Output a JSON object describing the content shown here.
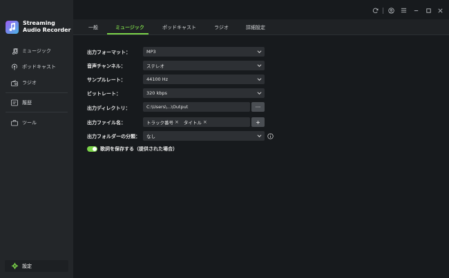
{
  "app": {
    "title_line1": "Streaming",
    "title_line2": "Audio Recorder"
  },
  "sidebar": {
    "items": [
      {
        "label": "ミュージック",
        "icon": "music-note-icon"
      },
      {
        "label": "ポッドキャスト",
        "icon": "podcast-icon"
      },
      {
        "label": "ラジオ",
        "icon": "radio-icon"
      },
      {
        "label": "履歴",
        "icon": "history-icon"
      },
      {
        "label": "ツール",
        "icon": "toolbox-icon"
      }
    ],
    "settings_label": "設定"
  },
  "tabs": [
    {
      "label": "一般"
    },
    {
      "label": "ミュージック",
      "active": true
    },
    {
      "label": "ポッドキャスト"
    },
    {
      "label": "ラジオ"
    },
    {
      "label": "詳細設定"
    }
  ],
  "form": {
    "output_format": {
      "label": "出力フォーマット：",
      "value": "MP3"
    },
    "audio_channel": {
      "label": "音声チャンネル：",
      "value": "ステレオ"
    },
    "sample_rate": {
      "label": "サンプルレート：",
      "value": "44100 Hz"
    },
    "bit_rate": {
      "label": "ビットレート：",
      "value": "320 kbps"
    },
    "output_dir": {
      "label": "出力ディレクトリ：",
      "value": "C:\\Users\\...\\Output",
      "browse": "···"
    },
    "output_filename": {
      "label": "出力ファイル名：",
      "tags": [
        "トラック番号",
        "タイトル"
      ],
      "add": "+"
    },
    "folder_classification": {
      "label": "出力フォルダーの分類：",
      "value": "なし"
    },
    "save_lyrics": {
      "label": "歌詞を保存する（提供された場合）",
      "enabled": true
    }
  },
  "colors": {
    "accent": "#7ad348",
    "sidebar_bg": "#232629",
    "main_bg": "#171a1d",
    "field_bg": "#2d3034"
  }
}
